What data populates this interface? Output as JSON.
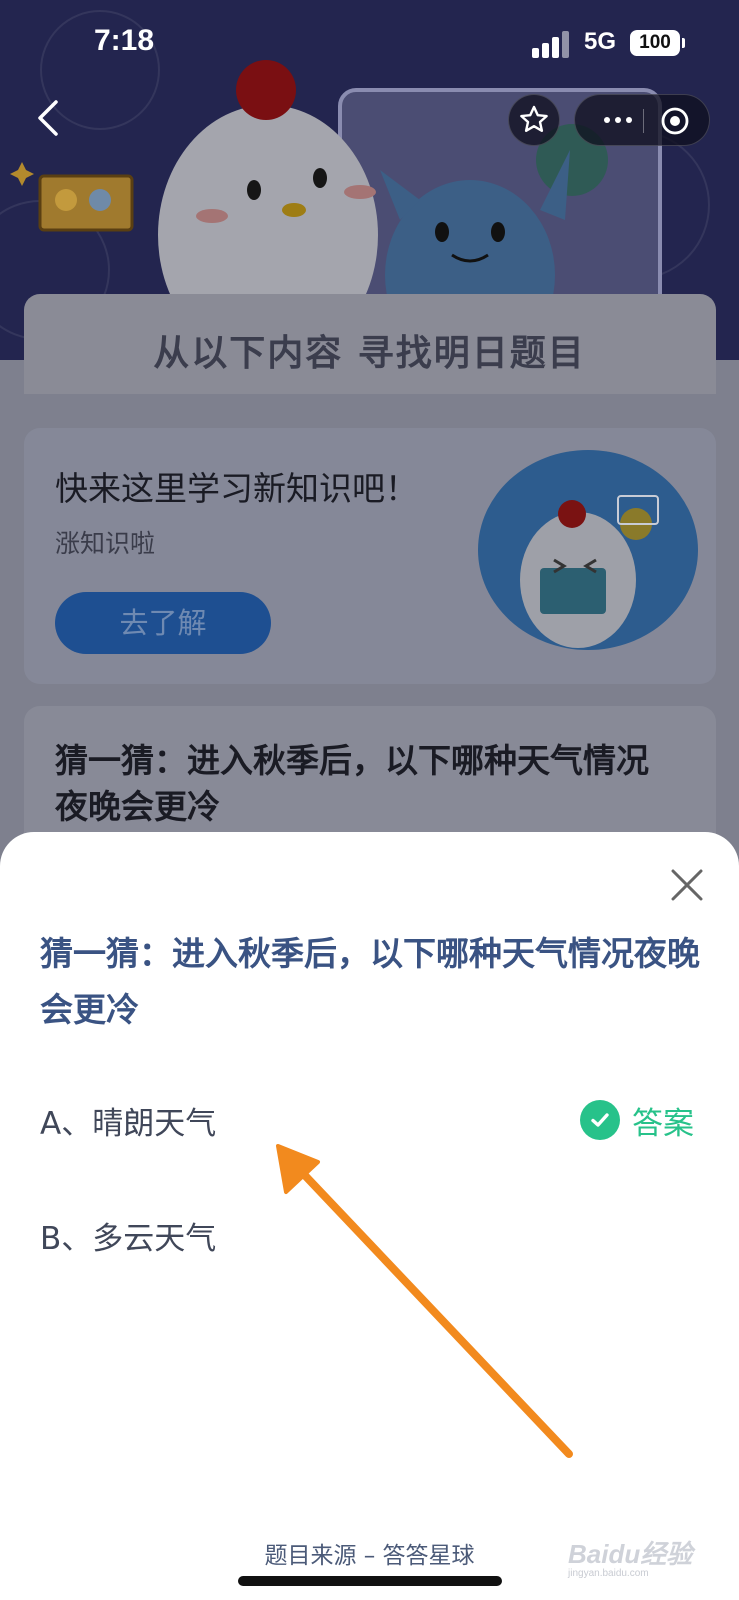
{
  "status_bar": {
    "time": "7:18",
    "network": "5G",
    "battery": "100"
  },
  "background": {
    "section_title": "从以下内容 寻找明日题目",
    "learn_card": {
      "title": "快来这里学习新知识吧！",
      "subtitle": "涨知识啦",
      "button_label": "去了解"
    },
    "question_card_text": "猜一猜：进入秋季后，以下哪种天气情况夜晚会更冷"
  },
  "sheet": {
    "question": "猜一猜：进入秋季后，以下哪种天气情况夜晚会更冷",
    "options": [
      {
        "label": "A、晴朗天气",
        "is_answer": true
      },
      {
        "label": "B、多云天气",
        "is_answer": false
      }
    ],
    "answer_label": "答案",
    "source": "题目来源 – 答答星球"
  },
  "watermark": {
    "text": "Baidu经验",
    "sub": "jingyan.baidu.com"
  },
  "colors": {
    "question_text": "#3a5383",
    "answer_green": "#27c28a",
    "annotation_arrow": "#f28a1e",
    "hero_bg": "#23254f"
  },
  "icons": {
    "back": "chevron-left-icon",
    "favorite": "star-icon",
    "more": "more-dots-icon",
    "target": "target-icon",
    "close": "close-icon",
    "check": "check-icon"
  }
}
